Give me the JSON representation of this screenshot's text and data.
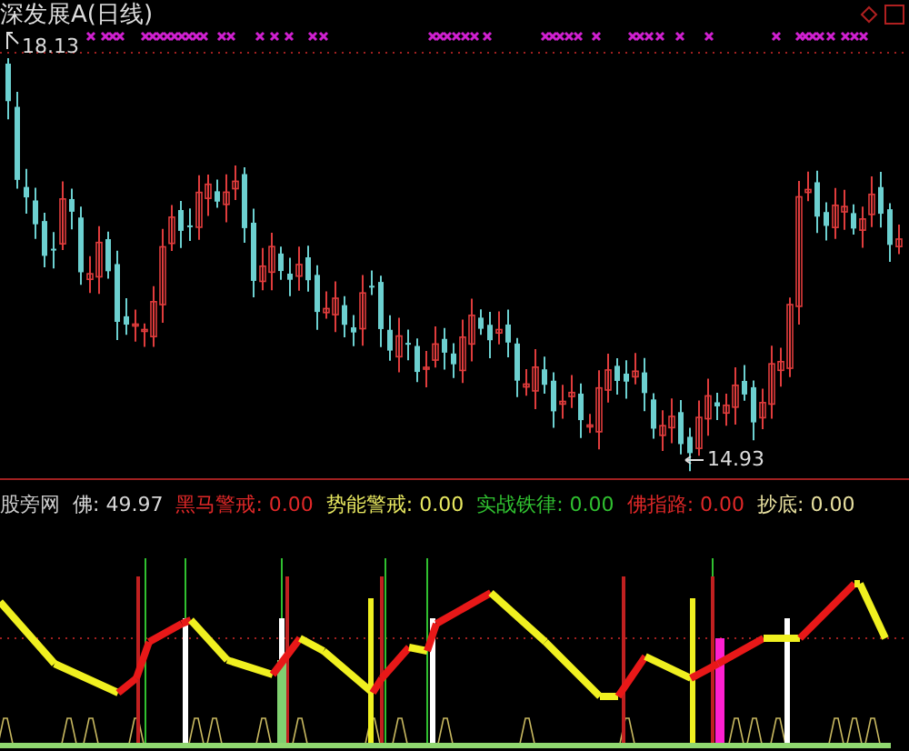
{
  "chart": {
    "title": "深发展A(日线)",
    "high_label": "18.13",
    "low_label": "14.93"
  },
  "indicator": {
    "name": "股旁网",
    "readings": [
      {
        "label": "佛:",
        "value": "49.97",
        "color": "#d8d8d8"
      },
      {
        "label": "黑马警戒:",
        "value": "0.00",
        "color": "#e02828"
      },
      {
        "label": "势能警戒:",
        "value": "0.00",
        "color": "#e8e860"
      },
      {
        "label": "实战铁律:",
        "value": "0.00",
        "color": "#30c030"
      },
      {
        "label": "佛指路:",
        "value": "0.00",
        "color": "#e02828"
      },
      {
        "label": "抄底:",
        "value": "0.00",
        "color": "#e8e0a0"
      }
    ]
  }
}
